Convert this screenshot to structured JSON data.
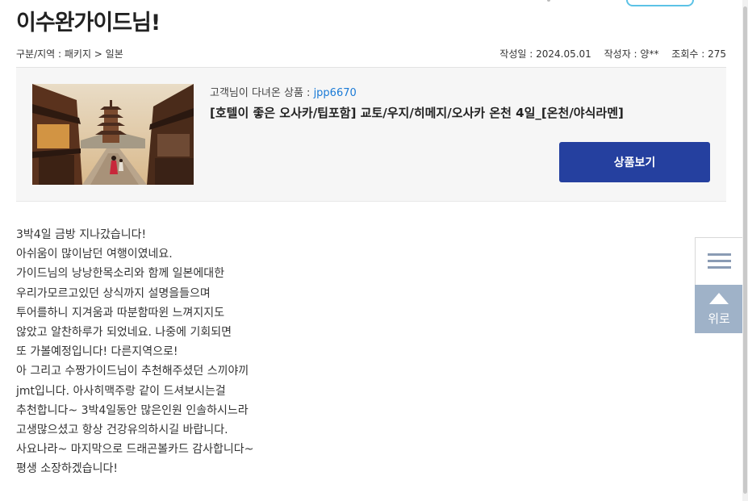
{
  "page": {
    "title": "이수완가이드님!"
  },
  "meta": {
    "category": "구분/지역 : 패키지 > 일본",
    "date": "작성일 : 2024.05.01",
    "author": "작성자 : 양**",
    "views": "조회수 : 275"
  },
  "product": {
    "label_prefix": "고객님이 다녀온 상품 : ",
    "code": "jpp6670",
    "title": "[호텔이 좋은 오사카/팁포함] 교토/우지/히메지/오사카 온천 4일_[온천/야식라멘]",
    "button_label": "상품보기",
    "image_icon": "kyoto-pagoda-street-photo",
    "button_color": "#25409f"
  },
  "review": {
    "lines": [
      "3박4일 금방 지나갔습니다!",
      "아쉬움이 많이남던 여행이였네요.",
      "가이드님의 낭낭한목소리와 함께 일본에대한",
      "우리가모르고있던 상식까지 설명을들으며",
      "투어를하니 지겨움과 따분함따윈 느껴지지도",
      "않았고 알찬하루가 되었네요. 나중에 기회되면",
      "또 가볼예정입니다! 다른지역으로!",
      "아 그리고 수짱가이드님이 추천해주셨던 스끼야끼",
      "jmt입니다. 아사히맥주랑 같이 드셔보시는걸",
      "추천합니다~ 3박4일동안 많은인원 인솔하시느라",
      "고생많으셨고 항상 건강유의하시길 바랍니다.",
      "사요나라~ 마지막으로 드래곤볼카드 감사합니다~",
      "평생 소장하겠습니다!"
    ]
  },
  "side": {
    "menu_icon": "hamburger-icon",
    "top_label": "위로",
    "top_icon": "arrow-up-icon"
  }
}
